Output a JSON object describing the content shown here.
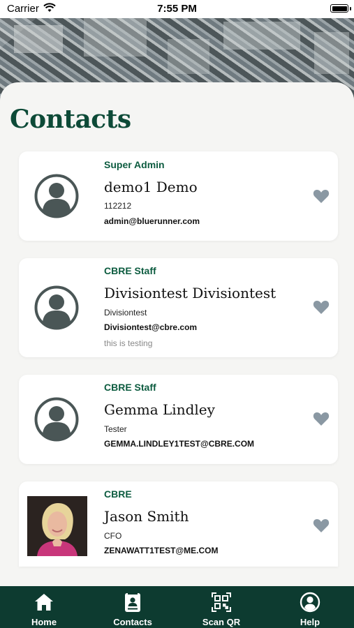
{
  "status_bar": {
    "carrier": "Carrier",
    "time": "7:55 PM"
  },
  "page": {
    "title": "Contacts"
  },
  "contacts": [
    {
      "role": "Super Admin",
      "name": "demo1 Demo",
      "title": "112212",
      "email": "admin@bluerunner.com",
      "note": "",
      "favorite": true
    },
    {
      "role": "CBRE Staff",
      "name": "Divisiontest Divisiontest",
      "title": "Divisiontest",
      "email": "Divisiontest@cbre.com",
      "note": "this is testing",
      "favorite": true
    },
    {
      "role": "CBRE Staff",
      "name": "Gemma Lindley",
      "title": "Tester",
      "email": "GEMMA.LINDLEY1TEST@CBRE.COM",
      "note": "",
      "favorite": true
    },
    {
      "role": "CBRE",
      "name": "Jason Smith",
      "title": "CFO",
      "email": "ZENAWATT1TEST@ME.COM",
      "note": "",
      "favorite": true
    }
  ],
  "tabbar": {
    "items": [
      {
        "label": "Home",
        "icon": "home-icon"
      },
      {
        "label": "Contacts",
        "icon": "contacts-icon"
      },
      {
        "label": "Scan QR",
        "icon": "qr-code-icon"
      },
      {
        "label": "Help",
        "icon": "help-icon"
      }
    ]
  },
  "colors": {
    "brand": "#0d4a37",
    "accent": "#0d5c40",
    "tabbar": "#0d3b30",
    "heart": "#8a98a3",
    "avatar": "#4a5656"
  }
}
